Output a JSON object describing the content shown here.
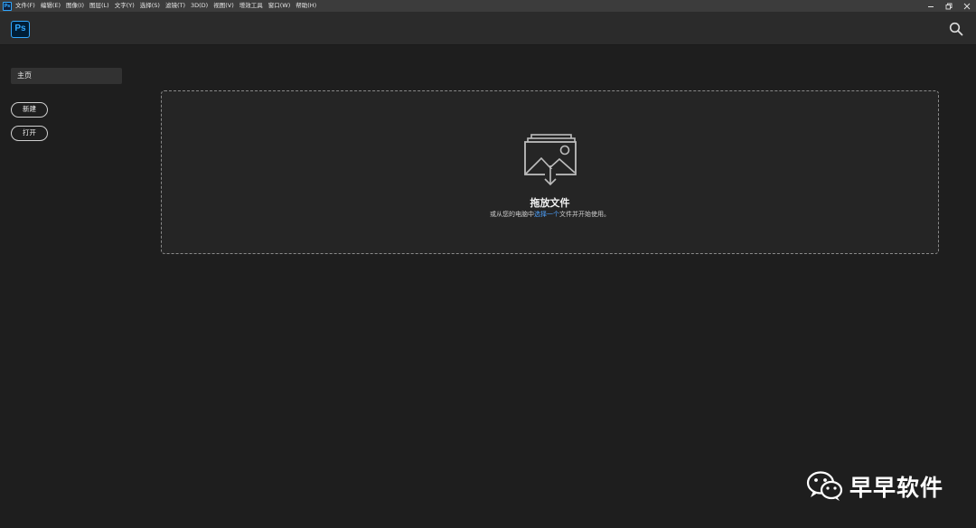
{
  "menubar": {
    "app_icon_text": "Ps",
    "items": [
      "文件(F)",
      "编辑(E)",
      "图像(I)",
      "图层(L)",
      "文字(Y)",
      "选择(S)",
      "滤镜(T)",
      "3D(D)",
      "视图(V)",
      "增效工具",
      "窗口(W)",
      "帮助(H)"
    ]
  },
  "header": {
    "logo_text": "Ps",
    "search_icon": "search-icon"
  },
  "sidebar": {
    "home_label": "主页",
    "new_label": "新建",
    "open_label": "打开"
  },
  "dropzone": {
    "icon": "image-stack-download-icon",
    "title": "拖放文件",
    "sub_before": "或从您的电脑中",
    "sub_link": "选择一个",
    "sub_after": "文件并开始使用。"
  },
  "watermark": {
    "icon": "wechat-icon",
    "text": "早早软件"
  },
  "colors": {
    "accent_blue": "#31a8ff",
    "link_blue": "#4ea3ff",
    "background": "#1e1e1e"
  }
}
